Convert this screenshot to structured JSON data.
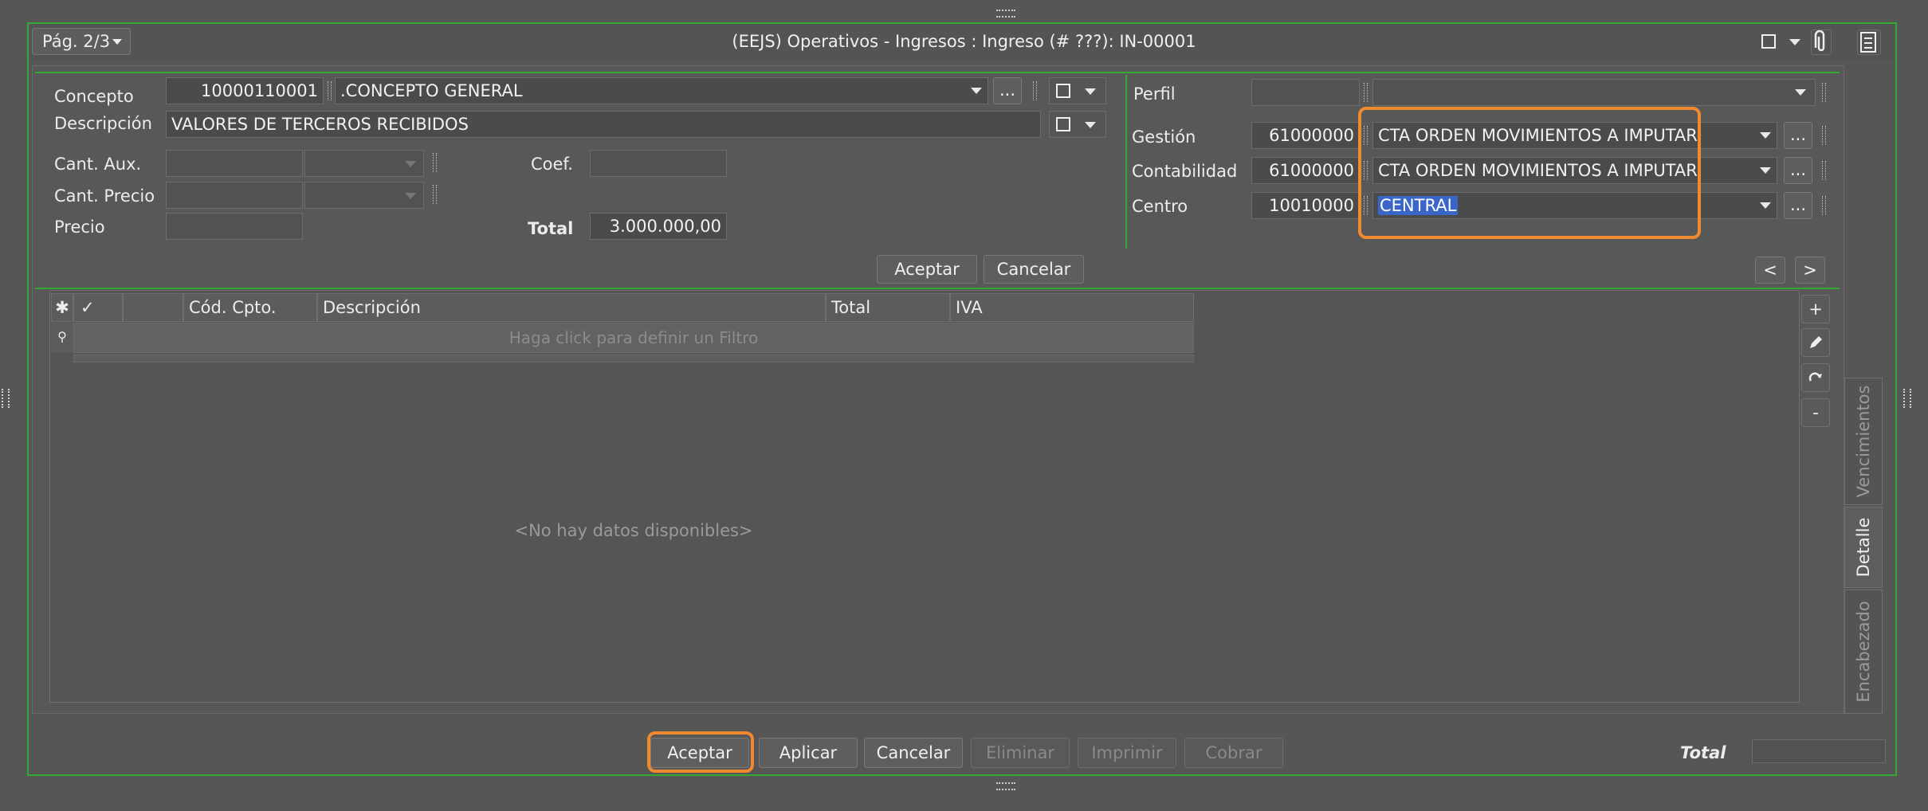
{
  "window": {
    "page_indicator": "Pág. 2/3",
    "title": "(EEJS) Operativos - Ingresos : Ingreso (# ???): IN-00001"
  },
  "form": {
    "concepto": {
      "label": "Concepto",
      "code": "10000110001",
      "value": ".CONCEPTO GENERAL"
    },
    "descripcion": {
      "label": "Descripción",
      "value": "VALORES DE TERCEROS RECIBIDOS"
    },
    "cant_aux": {
      "label": "Cant. Aux."
    },
    "cant_precio": {
      "label": "Cant. Precio"
    },
    "precio": {
      "label": "Precio"
    },
    "coef": {
      "label": "Coef."
    },
    "total": {
      "label": "Total",
      "value": "3.000.000,00"
    },
    "perfil": {
      "label": "Perfil"
    },
    "gestion": {
      "label": "Gestión",
      "code": "61000000",
      "value": "CTA ORDEN MOVIMIENTOS A IMPUTAR"
    },
    "contabilidad": {
      "label": "Contabilidad",
      "code": "61000000",
      "value": "CTA ORDEN MOVIMIENTOS A IMPUTAR"
    },
    "centro": {
      "label": "Centro",
      "code": "10010000",
      "value": "CENTRAL"
    },
    "accept_label": "Aceptar",
    "cancel_label": "Cancelar",
    "ellipsis": "...",
    "prev": "<",
    "next": ">"
  },
  "grid": {
    "columns": [
      "Cód. Cpto.",
      "Descripción",
      "Total",
      "IVA"
    ],
    "filter_placeholder": "Haga click para definir un Filtro",
    "empty_text": "<No hay datos disponibles>",
    "side_buttons": [
      "+",
      "-"
    ]
  },
  "side_tabs": [
    "Vencimientos",
    "Detalle",
    "Encabezado"
  ],
  "footer": {
    "buttons": [
      "Aceptar",
      "Aplicar",
      "Cancelar",
      "Eliminar",
      "Imprimir",
      "Cobrar"
    ],
    "total_label": "Total"
  },
  "colors": {
    "highlight": "#f08a30",
    "frame": "#34a834",
    "selection": "#3a66c8"
  }
}
